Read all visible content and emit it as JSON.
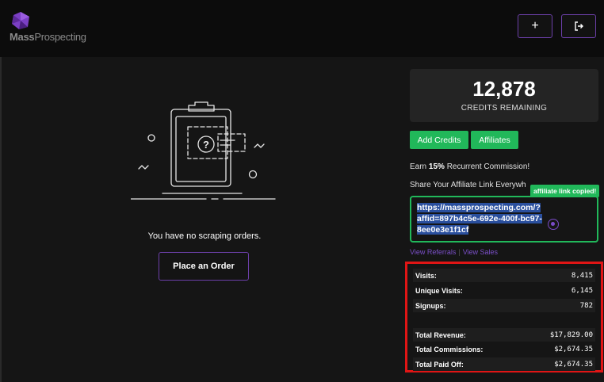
{
  "header": {
    "logo_bold": "Mass",
    "logo_light": "Prospecting",
    "buttons": [
      {
        "label": "+",
        "icon": "plus-icon"
      },
      {
        "label": "⇥",
        "icon": "logout-icon"
      }
    ]
  },
  "orders": {
    "empty_message": "You have no scraping orders.",
    "place_order_label": "Place an Order"
  },
  "credits": {
    "value": "12,878",
    "label": "CREDITS REMAINING"
  },
  "actions": {
    "add_credits": "Add Credits",
    "affiliates": "Affiliates"
  },
  "affiliate": {
    "earn_prefix": "Earn ",
    "earn_pct": "15%",
    "earn_suffix": " Recurrent Commission!",
    "share_text": "Share Your Affiliate Link Everywh",
    "copied_badge": "affiliate link copied!",
    "link_line1": "https://massprospecting.com/?",
    "link_line2": "affid=897b4c5e-692e-400f-bc97-",
    "link_line3": "8ee0e3e1f1cf",
    "view_referrals": "View Referrals",
    "separator": "|",
    "view_sales": "View Sales"
  },
  "stats": [
    {
      "label": "Visits:",
      "value": "8,415"
    },
    {
      "label": "Unique Visits:",
      "value": "6,145"
    },
    {
      "label": "Signups:",
      "value": "782"
    },
    {
      "label": "Total Revenue:",
      "value": "$17,829.00"
    },
    {
      "label": "Total Commissions:",
      "value": "$2,674.35"
    },
    {
      "label": "Total Paid Off:",
      "value": "$2,674.35"
    }
  ],
  "colors": {
    "accent_purple": "#6b3fa8",
    "green": "#21b85a",
    "highlight_red": "#e01515",
    "background": "#151515"
  }
}
